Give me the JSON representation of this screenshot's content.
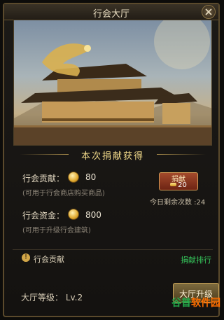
{
  "window": {
    "title": "行会大厅"
  },
  "section": {
    "title": "本次捐献获得"
  },
  "contribution": {
    "label": "行会贡献：",
    "value": "80",
    "note": "(可用于行会商店购买商品)"
  },
  "funds": {
    "label": "行会资金：",
    "value": "800",
    "note": "(可用于升级行会建筑)"
  },
  "donate": {
    "label": "捐献",
    "cost": "20"
  },
  "remaining": {
    "text": "今日剩余次数 :24"
  },
  "info": {
    "label": "行会贡献",
    "rank_link": "捐献排行"
  },
  "level": {
    "text": "大厅等级：  Lv.2"
  },
  "upgrade": {
    "label": "大厅升级"
  },
  "watermark": {
    "part1": "谷普",
    "part2": "软件园"
  },
  "colors": {
    "accent_gold": "#d2a648",
    "link_green": "#35c25a",
    "donate_red": "#8e351f"
  },
  "icons": [
    "close-icon",
    "coin-icon",
    "info-icon"
  ]
}
